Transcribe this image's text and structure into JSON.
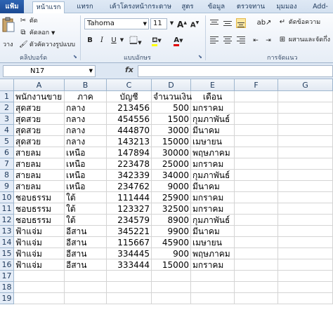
{
  "tabs": [
    "แฟ้ม",
    "หน้าแรก",
    "แทรก",
    "เค้าโครงหน้ากระดาษ",
    "สูตร",
    "ข้อมูล",
    "ตรวจทาน",
    "มุมมอง",
    "Add-"
  ],
  "ribbon": {
    "clipboard": {
      "paste_label": "วาง",
      "cut_label": "ตัด",
      "copy_label": "คัดลอก",
      "format_painter_label": "ตัวคัดวางรูปแบบ",
      "group_label": "คลิปบอร์ด"
    },
    "font": {
      "font_name": "Tahoma",
      "font_size": "11",
      "bold": "B",
      "italic": "I",
      "underline": "U",
      "grow": "A",
      "shrink": "A",
      "font_color_letter": "A",
      "group_label": "แบบอักษร"
    },
    "alignment": {
      "wrap_label": "ตัดข้อความ",
      "merge_label": "ผสานและจัดกึ่ง",
      "group_label": "การจัดแนว"
    }
  },
  "formula_bar": {
    "name_box": "N17",
    "fx": "fx",
    "formula": ""
  },
  "columns": [
    "A",
    "B",
    "C",
    "D",
    "E",
    "F",
    "G"
  ],
  "row_numbers": [
    "1",
    "2",
    "3",
    "4",
    "5",
    "6",
    "7",
    "8",
    "9",
    "10",
    "11",
    "12",
    "13",
    "14",
    "15",
    "16",
    "17",
    "18",
    "19"
  ],
  "headers": [
    "พนักงานขาย",
    "ภาค",
    "บัญชี",
    "จำนวนเงิน",
    "เดือน"
  ],
  "rows": [
    [
      "สุดสวย",
      "กลาง",
      "213456",
      "500",
      "มกราคม"
    ],
    [
      "สุดสวย",
      "กลาง",
      "454556",
      "1500",
      "กุมภาพันธ์"
    ],
    [
      "สุดสวย",
      "กลาง",
      "444870",
      "3000",
      "มีนาคม"
    ],
    [
      "สุดสวย",
      "กลาง",
      "143213",
      "15000",
      "เมษายน"
    ],
    [
      "สายลม",
      "เหนือ",
      "147894",
      "30000",
      "พฤษภาคม"
    ],
    [
      "สายลม",
      "เหนือ",
      "223478",
      "25000",
      "มกราคม"
    ],
    [
      "สายลม",
      "เหนือ",
      "342339",
      "34000",
      "กุมภาพันธ์"
    ],
    [
      "สายลม",
      "เหนือ",
      "234762",
      "9000",
      "มีนาคม"
    ],
    [
      "ชอบธรรม",
      "ใต้",
      "111444",
      "25900",
      "มกราคม"
    ],
    [
      "ชอบธรรม",
      "ใต้",
      "123327",
      "32500",
      "มกราคม"
    ],
    [
      "ชอบธรรม",
      "ใต้",
      "234579",
      "8900",
      "กุมภาพันธ์"
    ],
    [
      "ฟ้าแจ่ม",
      "อีสาน",
      "345221",
      "9900",
      "มีนาคม"
    ],
    [
      "ฟ้าแจ่ม",
      "อีสาน",
      "115667",
      "45900",
      "เมษายน"
    ],
    [
      "ฟ้าแจ่ม",
      "อีสาน",
      "334445",
      "900",
      "พฤษภาคม"
    ],
    [
      "ฟ้าแจ่ม",
      "อีสาน",
      "333444",
      "15000",
      "มกราคม"
    ]
  ],
  "colors": {
    "file_tab": "#2d64b3",
    "header_bg": "#e4ecf7",
    "gridline": "#d4d4d4"
  }
}
